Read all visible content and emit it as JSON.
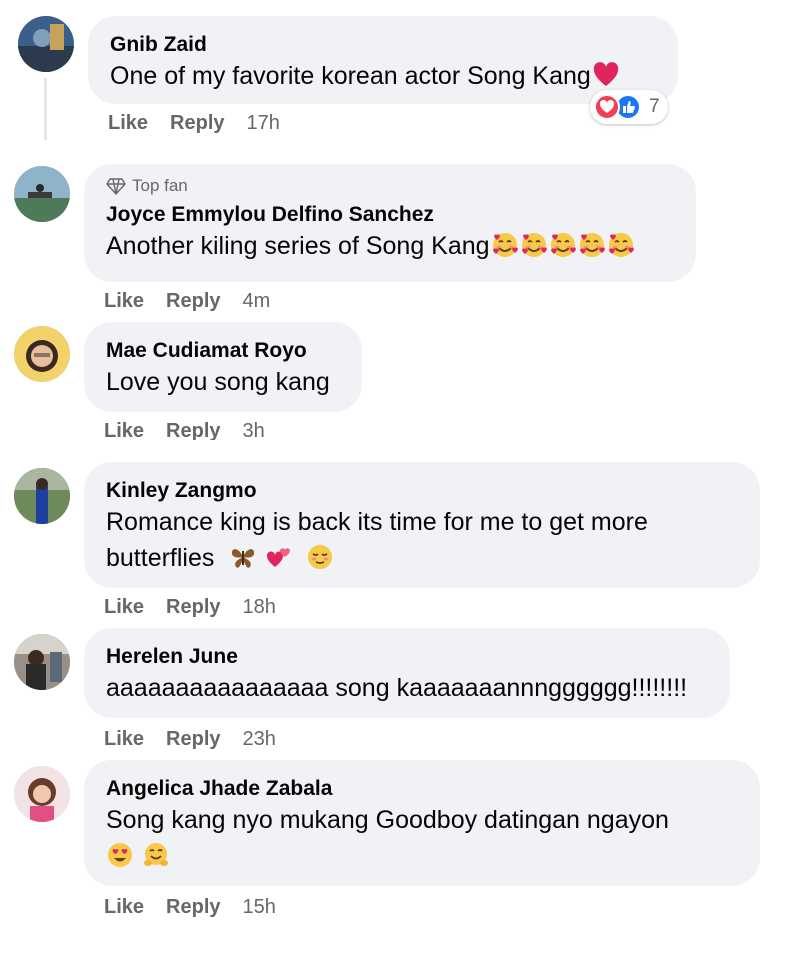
{
  "comments": [
    {
      "author": "Gnib Zaid",
      "text": "One of my favorite korean actor Song Kang",
      "actions": {
        "like": "Like",
        "reply": "Reply",
        "time": "17h"
      },
      "reactions": {
        "count": "7",
        "icons": [
          "love-icon",
          "like-icon"
        ]
      },
      "emoji": [
        "red-heart"
      ]
    },
    {
      "badge": "Top fan",
      "author": "Joyce Emmylou Delfino Sanchez",
      "text": "Another kiling series of Song Kang",
      "actions": {
        "like": "Like",
        "reply": "Reply",
        "time": "4m"
      },
      "emoji": [
        "smiling-face-with-hearts",
        "smiling-face-with-hearts",
        "smiling-face-with-hearts",
        "smiling-face-with-hearts",
        "smiling-face-with-hearts"
      ]
    },
    {
      "author": "Mae Cudiamat Royo",
      "text": "Love you song kang",
      "actions": {
        "like": "Like",
        "reply": "Reply",
        "time": "3h"
      }
    },
    {
      "author": "Kinley Zangmo",
      "text": "Romance king is back its time for me to get more",
      "text2": "butterflies",
      "actions": {
        "like": "Like",
        "reply": "Reply",
        "time": "18h"
      },
      "emoji": [
        "butterfly",
        "two-hearts",
        "relieved-face"
      ]
    },
    {
      "author": "Herelen June",
      "text": "aaaaaaaaaaaaaaaa song kaaaaaaannngggggg!!!!!!!!",
      "actions": {
        "like": "Like",
        "reply": "Reply",
        "time": "23h"
      }
    },
    {
      "author": "Angelica Jhade Zabala",
      "text": "Song kang nyo mukang Goodboy datingan ngayon",
      "actions": {
        "like": "Like",
        "reply": "Reply",
        "time": "15h"
      },
      "emoji": [
        "heart-eyes-face",
        "hugging-face"
      ]
    }
  ],
  "colors": {
    "bubble": "#f0f2f5",
    "meta": "#65676b",
    "like_blue": "#1877f2",
    "love_red": "#f33e58"
  }
}
